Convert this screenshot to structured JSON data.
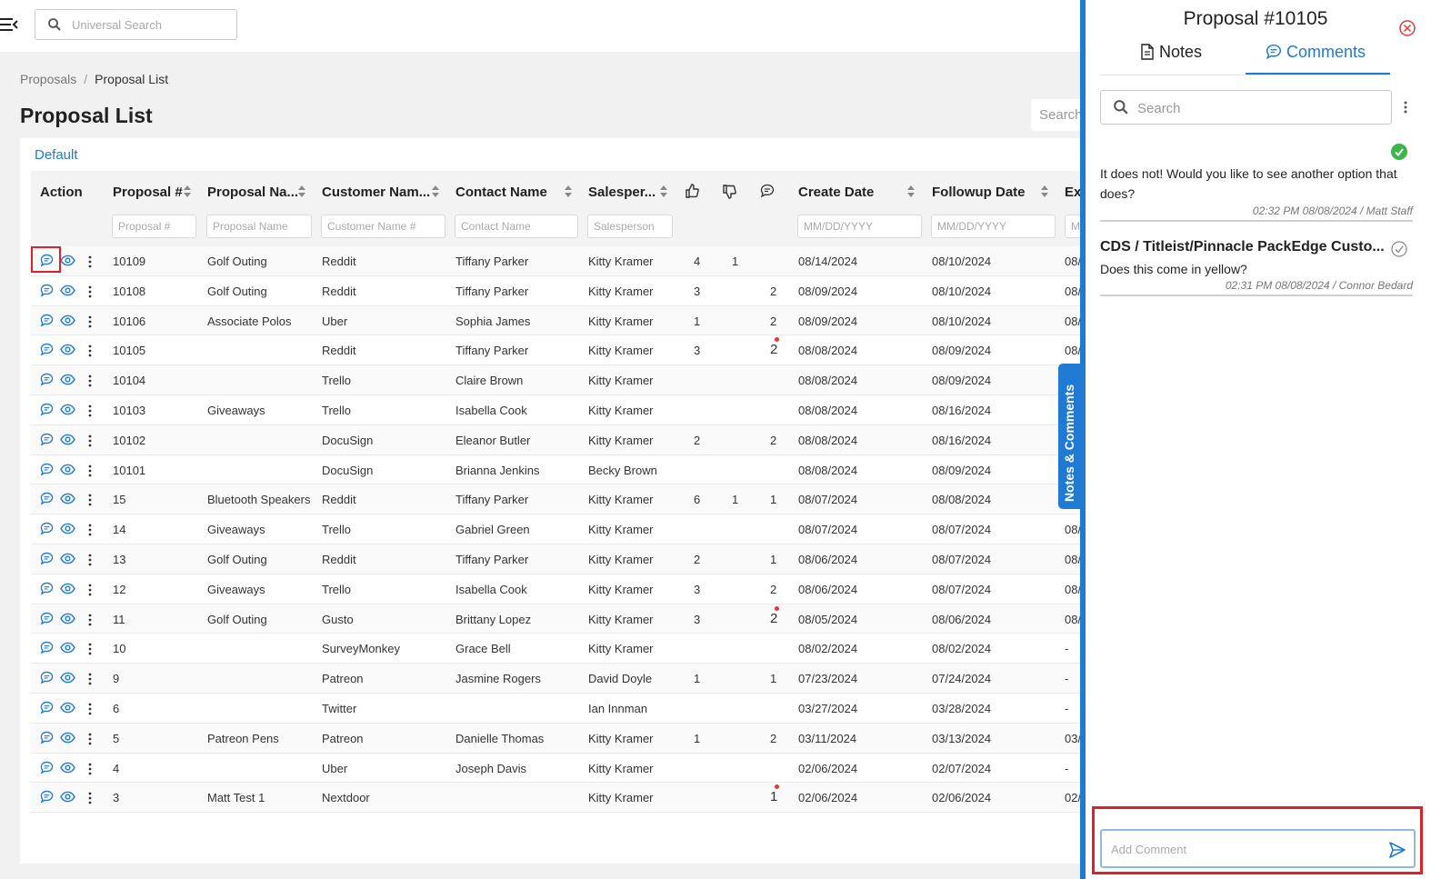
{
  "topbar": {
    "search_placeholder": "Universal Search"
  },
  "breadcrumb": {
    "parent": "Proposals",
    "separator": "/",
    "current": "Proposal List"
  },
  "page": {
    "title": "Proposal List",
    "search_label": "Search",
    "view_tab": "Default"
  },
  "table": {
    "headers": {
      "action": "Action",
      "proposal_num": "Proposal #",
      "proposal_name": "Proposal Na...",
      "customer_name": "Customer Nam...",
      "contact_name": "Contact Name",
      "salesperson": "Salesper...",
      "create_date": "Create Date",
      "followup_date": "Followup Date",
      "exp": "Ex"
    },
    "filters": {
      "proposal_num": "Proposal #",
      "proposal_name": "Proposal Name",
      "customer_name": "Customer Name #",
      "contact_name": "Contact Name",
      "salesperson": "Salesperson",
      "create_date": "MM/DD/YYYY",
      "followup_date": "MM/DD/YYYY",
      "exp": "M"
    },
    "rows": [
      {
        "num": "10109",
        "name": "Golf Outing",
        "customer": "Reddit",
        "contact": "Tiffany Parker",
        "sales": "Kitty Kramer",
        "up": "4",
        "down": "1",
        "comments": "",
        "unread": false,
        "create": "08/14/2024",
        "followup": "08/10/2024",
        "exp": "08/"
      },
      {
        "num": "10108",
        "name": "Golf Outing",
        "customer": "Reddit",
        "contact": "Tiffany Parker",
        "sales": "Kitty Kramer",
        "up": "3",
        "down": "",
        "comments": "2",
        "unread": false,
        "create": "08/09/2024",
        "followup": "08/10/2024",
        "exp": "08/"
      },
      {
        "num": "10106",
        "name": "Associate Polos",
        "customer": "Uber",
        "contact": "Sophia James",
        "sales": "Kitty Kramer",
        "up": "1",
        "down": "",
        "comments": "2",
        "unread": false,
        "create": "08/09/2024",
        "followup": "08/10/2024",
        "exp": "08/"
      },
      {
        "num": "10105",
        "name": "",
        "customer": "Reddit",
        "contact": "Tiffany Parker",
        "sales": "Kitty Kramer",
        "up": "3",
        "down": "",
        "comments": "2",
        "unread": true,
        "create": "08/08/2024",
        "followup": "08/09/2024",
        "exp": "08/"
      },
      {
        "num": "10104",
        "name": "",
        "customer": "Trello",
        "contact": "Claire Brown",
        "sales": "Kitty Kramer",
        "up": "",
        "down": "",
        "comments": "",
        "unread": false,
        "create": "08/08/2024",
        "followup": "08/09/2024",
        "exp": ""
      },
      {
        "num": "10103",
        "name": "Giveaways",
        "customer": "Trello",
        "contact": "Isabella Cook",
        "sales": "Kitty Kramer",
        "up": "",
        "down": "",
        "comments": "",
        "unread": false,
        "create": "08/08/2024",
        "followup": "08/16/2024",
        "exp": ""
      },
      {
        "num": "10102",
        "name": "",
        "customer": "DocuSign",
        "contact": "Eleanor Butler",
        "sales": "Kitty Kramer",
        "up": "2",
        "down": "",
        "comments": "2",
        "unread": false,
        "create": "08/08/2024",
        "followup": "08/16/2024",
        "exp": ""
      },
      {
        "num": "10101",
        "name": "",
        "customer": "DocuSign",
        "contact": "Brianna Jenkins",
        "sales": "Becky Brown",
        "up": "",
        "down": "",
        "comments": "",
        "unread": false,
        "create": "08/08/2024",
        "followup": "08/09/2024",
        "exp": ""
      },
      {
        "num": "15",
        "name": "Bluetooth Speakers",
        "customer": "Reddit",
        "contact": "Tiffany Parker",
        "sales": "Kitty Kramer",
        "up": "6",
        "down": "1",
        "comments": "1",
        "unread": false,
        "create": "08/07/2024",
        "followup": "08/08/2024",
        "exp": ""
      },
      {
        "num": "14",
        "name": "Giveaways",
        "customer": "Trello",
        "contact": "Gabriel Green",
        "sales": "Kitty Kramer",
        "up": "",
        "down": "",
        "comments": "",
        "unread": false,
        "create": "08/07/2024",
        "followup": "08/07/2024",
        "exp": "08/"
      },
      {
        "num": "13",
        "name": "Golf Outing",
        "customer": "Reddit",
        "contact": "Tiffany Parker",
        "sales": "Kitty Kramer",
        "up": "2",
        "down": "",
        "comments": "1",
        "unread": false,
        "create": "08/06/2024",
        "followup": "08/07/2024",
        "exp": "08/"
      },
      {
        "num": "12",
        "name": "Giveaways",
        "customer": "Trello",
        "contact": "Isabella Cook",
        "sales": "Kitty Kramer",
        "up": "3",
        "down": "",
        "comments": "2",
        "unread": false,
        "create": "08/06/2024",
        "followup": "08/07/2024",
        "exp": "08/"
      },
      {
        "num": "11",
        "name": "Golf Outing",
        "customer": "Gusto",
        "contact": "Brittany Lopez",
        "sales": "Kitty Kramer",
        "up": "3",
        "down": "",
        "comments": "2",
        "unread": true,
        "create": "08/05/2024",
        "followup": "08/06/2024",
        "exp": "08/"
      },
      {
        "num": "10",
        "name": "",
        "customer": "SurveyMonkey",
        "contact": "Grace Bell",
        "sales": "Kitty Kramer",
        "up": "",
        "down": "",
        "comments": "",
        "unread": false,
        "create": "08/02/2024",
        "followup": "08/02/2024",
        "exp": "-"
      },
      {
        "num": "9",
        "name": "",
        "customer": "Patreon",
        "contact": "Jasmine Rogers",
        "sales": "David Doyle",
        "up": "1",
        "down": "",
        "comments": "1",
        "unread": false,
        "create": "07/23/2024",
        "followup": "07/24/2024",
        "exp": "-"
      },
      {
        "num": "6",
        "name": "",
        "customer": "Twitter",
        "contact": "",
        "sales": "Ian Innman",
        "up": "",
        "down": "",
        "comments": "",
        "unread": false,
        "create": "03/27/2024",
        "followup": "03/28/2024",
        "exp": "-"
      },
      {
        "num": "5",
        "name": "Patreon Pens",
        "customer": "Patreon",
        "contact": "Danielle Thomas",
        "sales": "Kitty Kramer",
        "up": "1",
        "down": "",
        "comments": "2",
        "unread": false,
        "create": "03/11/2024",
        "followup": "03/13/2024",
        "exp": "03/"
      },
      {
        "num": "4",
        "name": "",
        "customer": "Uber",
        "contact": "Joseph Davis",
        "sales": "Kitty Kramer",
        "up": "",
        "down": "",
        "comments": "",
        "unread": false,
        "create": "02/06/2024",
        "followup": "02/07/2024",
        "exp": "-"
      },
      {
        "num": "3",
        "name": "Matt Test 1",
        "customer": "Nextdoor",
        "contact": "",
        "sales": "Kitty Kramer",
        "up": "",
        "down": "",
        "comments": "1",
        "unread": true,
        "create": "02/06/2024",
        "followup": "02/06/2024",
        "exp": "02/"
      }
    ]
  },
  "side_tab": {
    "label": "Notes & Comments"
  },
  "panel": {
    "title": "Proposal #10105",
    "tabs": {
      "notes": "Notes",
      "comments": "Comments"
    },
    "search_placeholder": "Search",
    "comments": [
      {
        "heading": "",
        "text": "It does not! Would you like to see another option that does?",
        "meta": "02:32 PM 08/08/2024 / Matt Staff",
        "resolved": true
      },
      {
        "heading": "CDS / Titleist/Pinnacle PackEdge Custo...",
        "text": "Does this come in yellow?",
        "meta": "02:31 PM 08/08/2024 / Connor Bedard",
        "resolved": false
      }
    ],
    "add_comment_placeholder": "Add Comment"
  },
  "colors": {
    "accent": "#1f7ad3",
    "highlight": "#e0202a",
    "resolved": "#3cb54a",
    "close": "#e53935"
  },
  "icons": {
    "menu": "menu-collapse-icon",
    "search": "search-icon",
    "comment": "comment-icon",
    "view": "eye-icon",
    "more": "kebab-icon",
    "up": "thumbs-up-icon",
    "down": "thumbs-down-icon",
    "close": "close-circle-icon",
    "send": "send-icon"
  }
}
